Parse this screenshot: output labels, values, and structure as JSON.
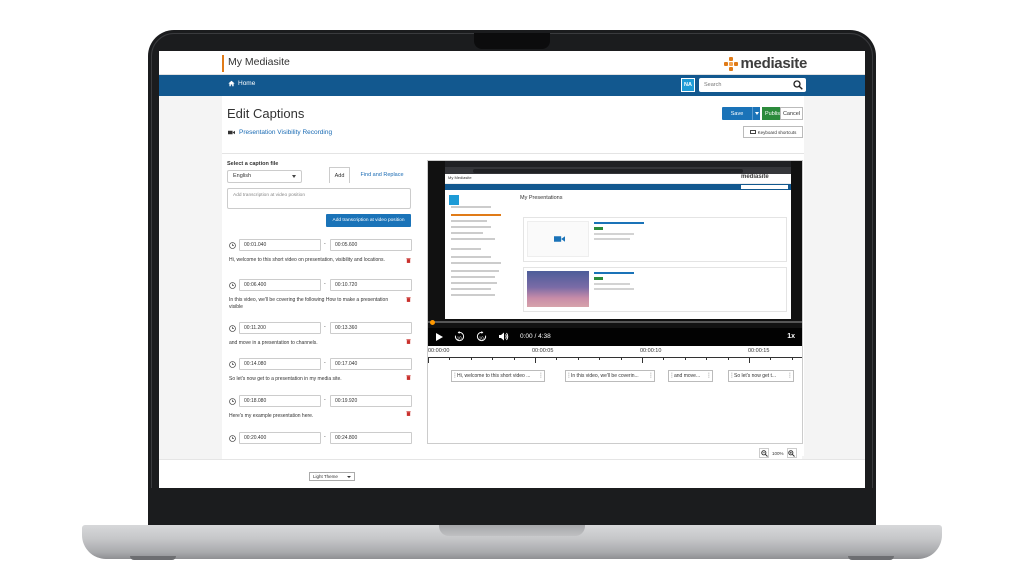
{
  "app": {
    "title": "My Mediasite",
    "logo": "mediasite",
    "brand_color": "#12588f",
    "accent_color": "#e07b18"
  },
  "nav": {
    "home_label": "Home",
    "user_initials": "NA",
    "search_placeholder": "Search"
  },
  "page": {
    "title": "Edit Captions",
    "recording_link": "Presentation Visibility Recording",
    "buttons": {
      "save": "Save",
      "publish": "Publish",
      "cancel": "Cancel",
      "keyboard_shortcuts": "Keyboard shortcuts"
    }
  },
  "editor": {
    "caption_file_label": "Select a caption file",
    "caption_file_value": "English",
    "tabs": {
      "add": "Add",
      "find_replace": "Find and Replace"
    },
    "transcript_placeholder": "Add transcription at video position",
    "add_transcript_button": "Add transcription at video position",
    "captions": [
      {
        "start": "00:01.040",
        "end": "00:05.600",
        "text": "Hi, welcome to this short video on presentation, visibility and locations."
      },
      {
        "start": "00:06.400",
        "end": "00:10.720",
        "text": "In this video, we'll be covering the following How to make a presentation visible"
      },
      {
        "start": "00:11.200",
        "end": "00:13.360",
        "text": "and move in a presentation to channels."
      },
      {
        "start": "00:14.080",
        "end": "00:17.040",
        "text": "So let's now get to a presentation in my media site."
      },
      {
        "start": "00:18.080",
        "end": "00:19.920",
        "text": "Here's my example presentation here."
      },
      {
        "start": "00:20.400",
        "end": "00:24.800",
        "text": ""
      }
    ]
  },
  "player": {
    "time": "0:00 / 4:38",
    "speed": "1x",
    "progress": 0,
    "inner": {
      "app_title": "My Mediasite",
      "heading": "My Presentations",
      "logo": "mediasite"
    }
  },
  "timeline": {
    "labels": [
      "00:00:00",
      "00:00:05",
      "00:00:10",
      "00:00:15"
    ],
    "segments": [
      "Hi, welcome to this short video ...",
      "In this video, we'll be coverin...",
      "and move...",
      "So let's now get t..."
    ],
    "zoom": "100%"
  },
  "footer": {
    "theme": "Light Theme"
  }
}
